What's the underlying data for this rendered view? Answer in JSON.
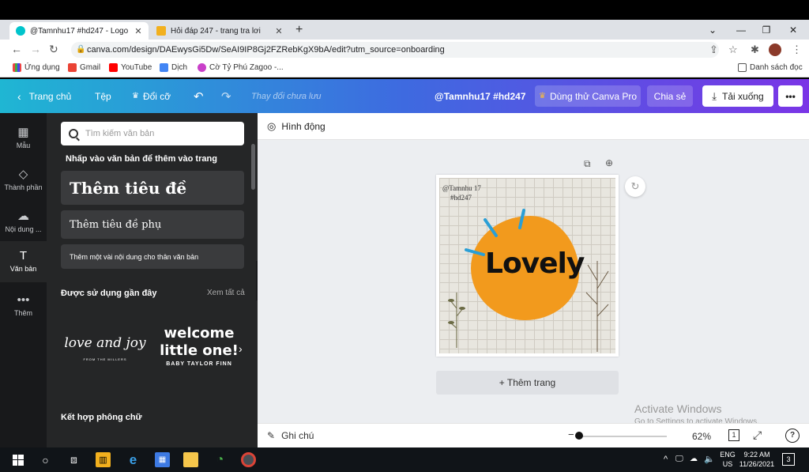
{
  "browser": {
    "tabs": [
      {
        "title": "@Tamnhu17 #hd247 - Logo",
        "active": true
      },
      {
        "title": "Hỏi đáp 247 - trang tra lơi",
        "active": false
      }
    ],
    "url": "canva.com/design/DAEwysGi5Dw/SeAI9IP8Gj2FZRebKgX9bA/edit?utm_source=onboarding",
    "bookmarks": [
      "Ứng dụng",
      "Gmail",
      "YouTube",
      "Dịch",
      "Cờ Tỷ Phú Zagoo -..."
    ],
    "reading_list": "Danh sách đọc"
  },
  "topbar": {
    "home": "Trang chủ",
    "file": "Tệp",
    "resize": "Đổi cỡ",
    "save_status": "Thay đổi chưa lưu",
    "design_title": "@Tamnhu17 #hd247",
    "try_pro": "Dùng thử Canva Pro",
    "share": "Chia sẻ",
    "download": "Tải xuống",
    "more": "•••"
  },
  "rail": [
    {
      "label": "Mẫu",
      "icon": "template-icon"
    },
    {
      "label": "Thành phần",
      "icon": "elements-icon"
    },
    {
      "label": "Nội dung ...",
      "icon": "upload-icon"
    },
    {
      "label": "Văn bản",
      "icon": "text-icon"
    },
    {
      "label": "Thêm",
      "icon": "more-icon"
    }
  ],
  "panel": {
    "search_placeholder": "Tìm kiếm văn bản",
    "hint": "Nhấp vào văn bản để thêm vào trang",
    "heading": "Thêm tiêu đề",
    "subheading": "Thêm tiêu đề phụ",
    "body": "Thêm một vài nội dung cho thân văn bản",
    "recent_title": "Được sử dụng gần đây",
    "see_all": "Xem tất cả",
    "fonts": [
      {
        "main": "love and joy",
        "sub": "FROM THE MILLERS"
      },
      {
        "main": "welcome little one!",
        "sub": "BABY TAYLOR FINN"
      }
    ],
    "combos": "Kết hợp phông chữ"
  },
  "canvas": {
    "animate": "Hình động",
    "design_text_1": "@Tamnhu 17",
    "design_text_2": "#hd247",
    "design_word": "Lovely",
    "add_page": "+ Thêm trang",
    "notes": "Ghi chú",
    "zoom": "62%",
    "page_count": "1",
    "help": "?"
  },
  "watermark": {
    "line1": "Activate Windows",
    "line2": "Go to Settings to activate Windows."
  },
  "taskbar": {
    "lang1": "ENG",
    "lang2": "US",
    "time": "9:22 AM",
    "date": "11/26/2021",
    "notif": "3"
  }
}
